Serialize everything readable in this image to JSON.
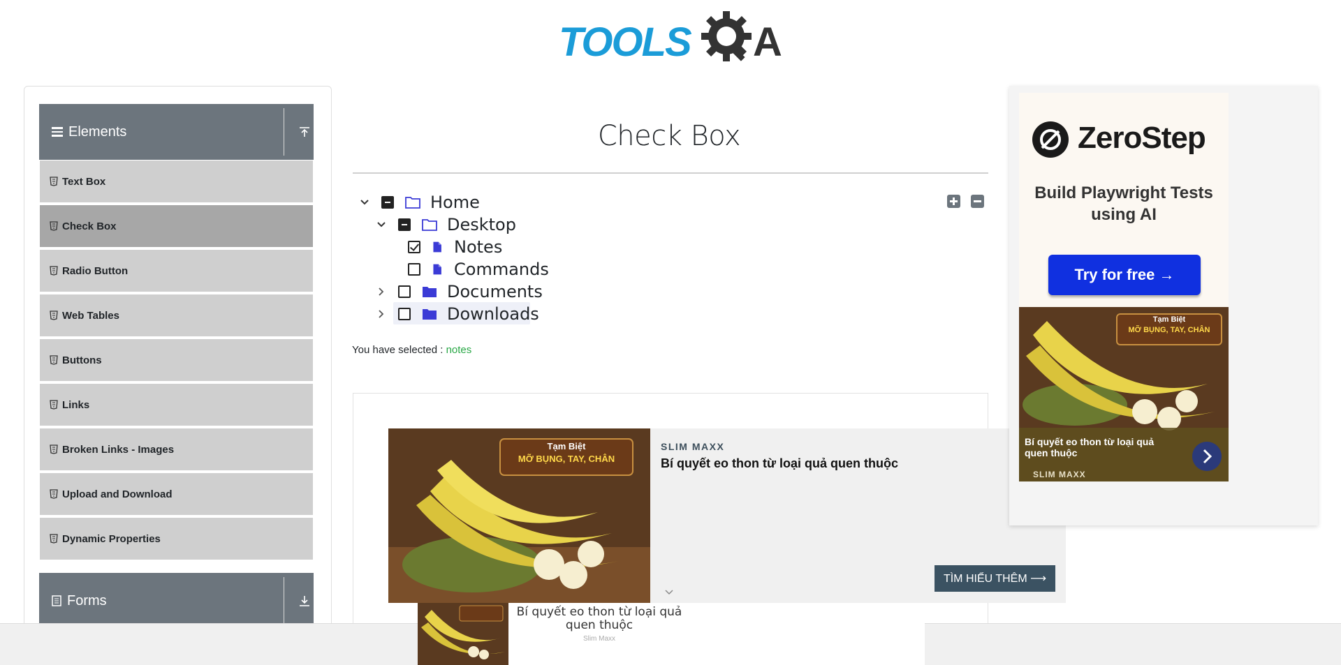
{
  "header": {
    "logo_text": "TOOLSQA"
  },
  "sidebar": {
    "group_elements": "Elements",
    "group_forms": "Forms",
    "items": [
      {
        "label": "Text Box"
      },
      {
        "label": "Check Box",
        "active": true
      },
      {
        "label": "Radio Button"
      },
      {
        "label": "Web Tables"
      },
      {
        "label": "Buttons"
      },
      {
        "label": "Links"
      },
      {
        "label": "Broken Links - Images"
      },
      {
        "label": "Upload and Download"
      },
      {
        "label": "Dynamic Properties"
      }
    ]
  },
  "main": {
    "title": "Check Box",
    "tree": {
      "home": "Home",
      "desktop": "Desktop",
      "notes": "Notes",
      "commands": "Commands",
      "documents": "Documents",
      "downloads": "Downloads"
    },
    "result_label": "You have selected :",
    "result_value": "notes"
  },
  "ads": {
    "main": {
      "brand": "SLIM MAXX",
      "headline": "Bí quyết eo thon từ loại quả quen thuộc",
      "cta": "TÌM HIỂU THÊM ⟶",
      "image_caption_line1": "Tạm Biệt",
      "image_caption_line2": "MỠ BỤNG, TAY, CHÂN"
    },
    "right": {
      "brand_name": "ZeroStep",
      "subtitle": "Build Playwright Tests using AI",
      "cta": "Try for free →",
      "image_caption_line1": "Tạm Biệt",
      "image_caption_line2": "MỠ BỤNG, TAY, CHÂN",
      "headline": "Bí quyết eo thon từ loại quả quen thuộc",
      "brand": "SLIM MAXX"
    },
    "bottom": {
      "headline": "Bí quyết eo thon từ loại quả quen thuộc",
      "brand": "Slim Maxx"
    }
  },
  "colors": {
    "sidebar_header": "#6c757d",
    "menu_item": "#cfcfcf",
    "menu_item_active": "#a7a7a7",
    "folder_icon": "#3b3bd6",
    "selected_text": "#28a745",
    "logo_blue": "#1b9cd8",
    "logo_dark": "#333333",
    "zerostep_cta": "#1030e0"
  }
}
